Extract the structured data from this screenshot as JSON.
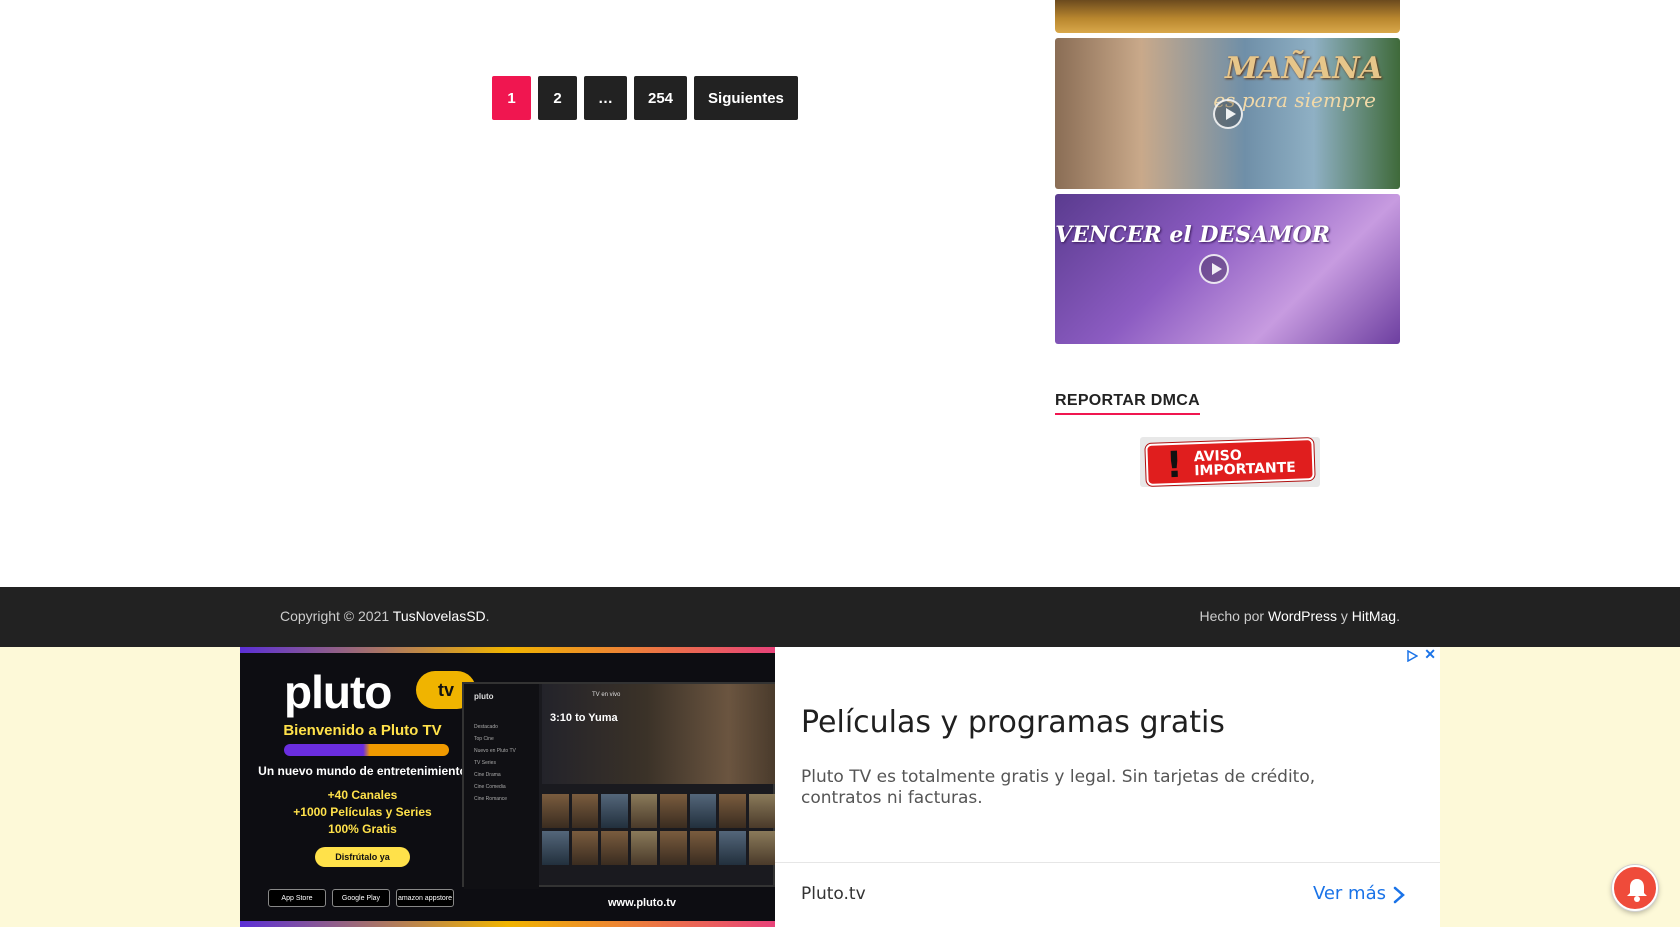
{
  "pagination": {
    "pages": [
      "1",
      "2",
      "…",
      "254"
    ],
    "next_label": "Siguientes",
    "current": "1"
  },
  "sidebar": {
    "thumbnails": [
      {
        "title": "MAÑANA",
        "subtitle": "es para siempre"
      },
      {
        "title": "VENCER el DESAMOR"
      }
    ],
    "dmca_heading": "REPORTAR DMCA",
    "dmca_badge_text": "AVISO IMPORTANTE"
  },
  "footer": {
    "copyright": "Copyright © 2021",
    "site_name": "TusNovelasSD",
    "made_by": "Hecho por",
    "wordpress": "WordPress",
    "and": "y",
    "theme": "HitMag",
    "period": "."
  },
  "ad": {
    "logo_text": "pluto",
    "logo_badge": "tv",
    "welcome": "Bienvenido a Pluto TV",
    "tagline": "Un nuevo mundo de entretenimiento",
    "stats": [
      "+40 Canales",
      "+1000 Películas y Series",
      "100% Gratis"
    ],
    "cta": "Disfrútalo ya",
    "stores": [
      "App Store",
      "Google Play",
      "amazon appstore"
    ],
    "screen_brand": "pluto",
    "screen_live": "TV en vivo",
    "screen_movie": "3:10 to Yuma",
    "screen_menu": [
      "Destacado",
      "Top Cine",
      "Nuevo en Pluto TV",
      "TV Series",
      "Cine Drama",
      "Cine Comedia",
      "Cine Romance"
    ],
    "url": "www.pluto.tv",
    "title": "Películas y programas gratis",
    "description": "Pluto TV es totalmente gratis y legal. Sin tarjetas de crédito, contratos ni facturas.",
    "domain": "Pluto.tv",
    "more_label": "Ver más"
  },
  "colors": {
    "accent": "#f01650",
    "footer_bg": "#222222",
    "ad_link": "#1a73e8",
    "bell": "#ef4b3a"
  }
}
